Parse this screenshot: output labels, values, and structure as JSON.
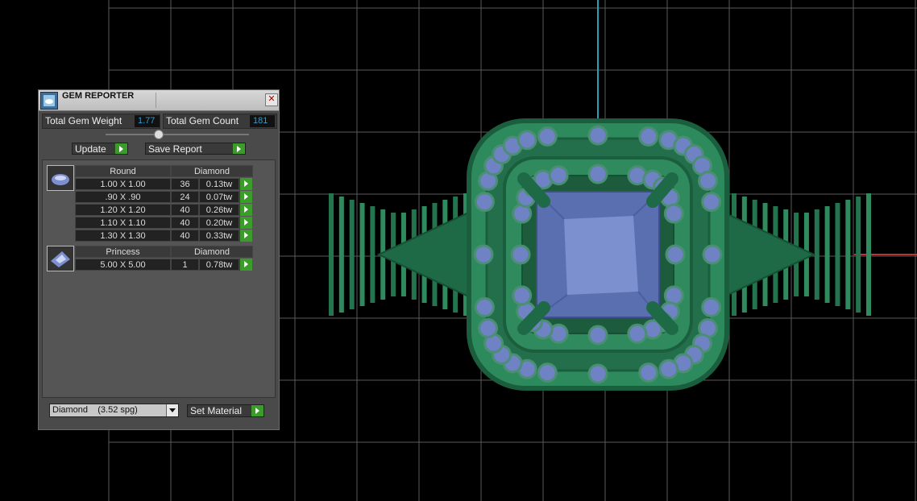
{
  "panel": {
    "title": "GEM REPORTER",
    "close_glyph": "✕",
    "total_weight_label": "Total Gem Weight",
    "total_weight_value": "1.77",
    "total_count_label": "Total Gem Count",
    "total_count_value": "181",
    "update_label": "Update",
    "save_report_label": "Save Report",
    "groups": [
      {
        "shape": "Round",
        "material": "Diamond",
        "icon": "round-gem-icon",
        "rows": [
          {
            "size": "1.00 X 1.00",
            "count": "36",
            "weight": "0.13tw"
          },
          {
            "size": ".90 X .90",
            "count": "24",
            "weight": "0.07tw"
          },
          {
            "size": "1.20 X 1.20",
            "count": "40",
            "weight": "0.26tw"
          },
          {
            "size": "1.10 X 1.10",
            "count": "40",
            "weight": "0.20tw"
          },
          {
            "size": "1.30 X 1.30",
            "count": "40",
            "weight": "0.33tw"
          }
        ]
      },
      {
        "shape": "Princess",
        "material": "Diamond",
        "icon": "princess-gem-icon",
        "rows": [
          {
            "size": "5.00 X 5.00",
            "count": "1",
            "weight": "0.78tw"
          }
        ]
      }
    ],
    "material_select": "Diamond    (3.52 spg)",
    "set_material_label": "Set Material"
  },
  "colors": {
    "metal": "#2f8a5e",
    "stone": "#6f82c4",
    "accent_button": "#3c9c2b",
    "value_text": "#3399cc"
  }
}
